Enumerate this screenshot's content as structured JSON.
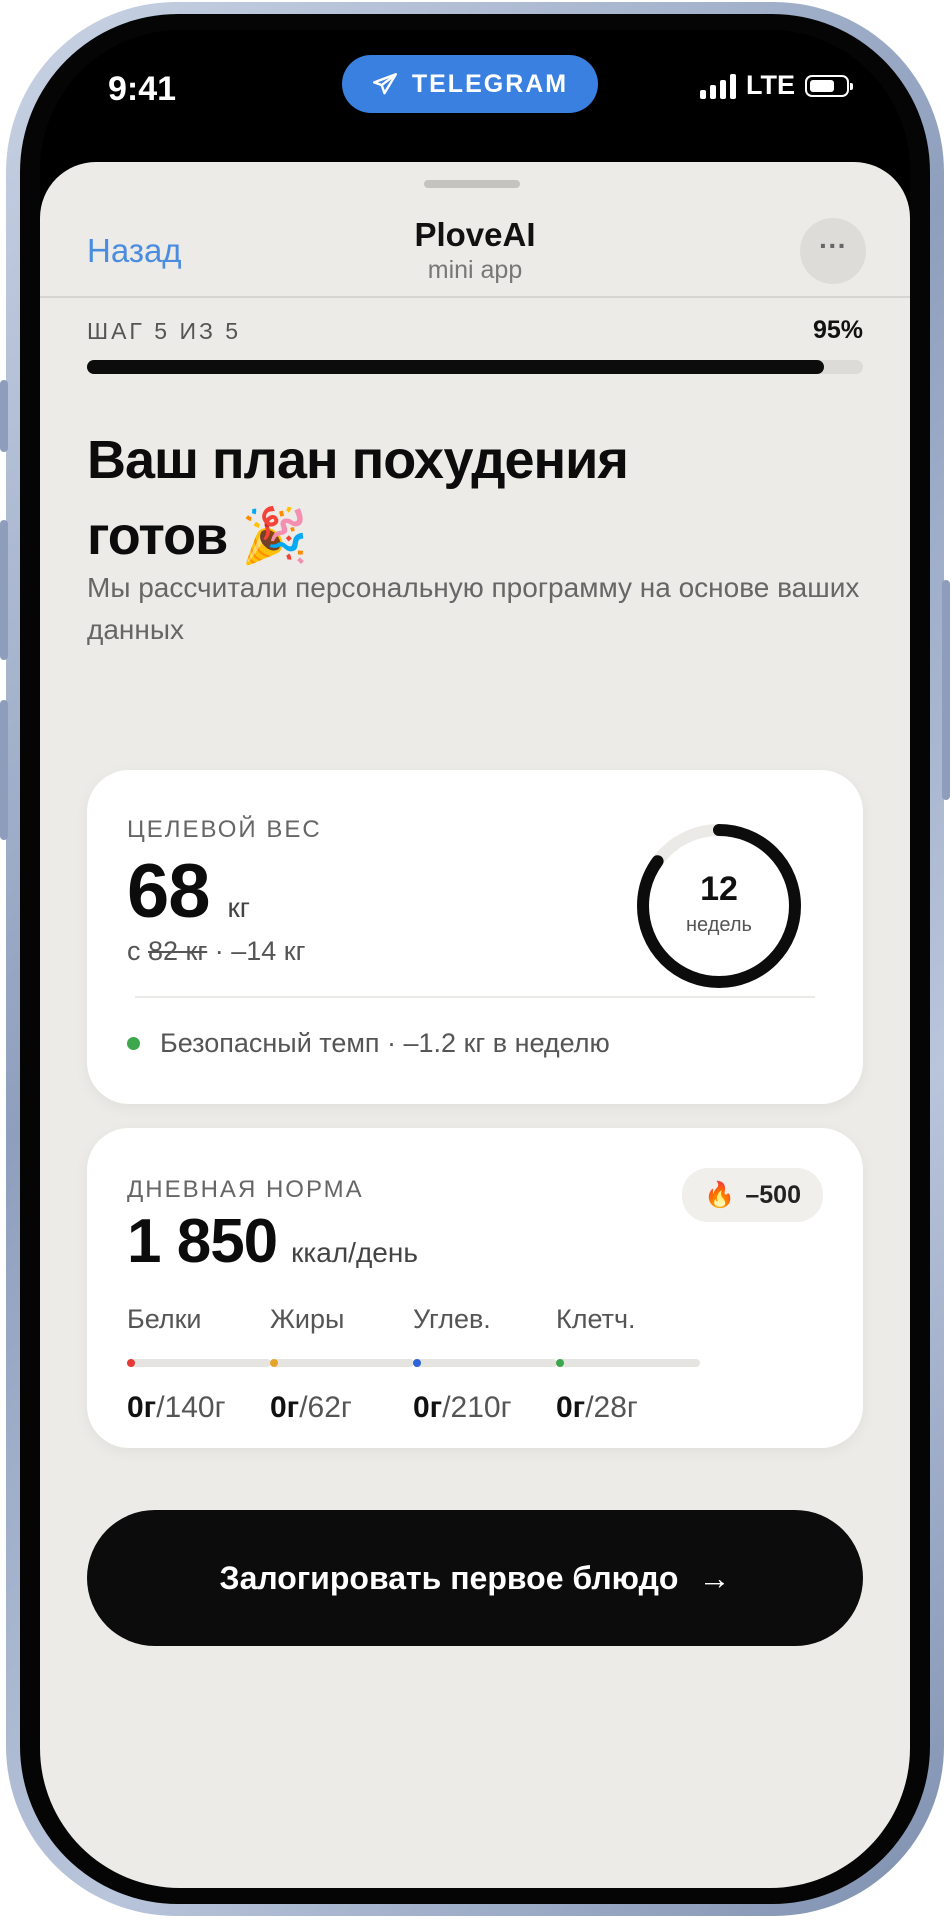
{
  "status_bar": {
    "time": "9:41",
    "network": "LTE",
    "telegram_label": "TELEGRAM"
  },
  "nav": {
    "back": "Назад",
    "title": "PloveAI",
    "subtitle": "mini app",
    "more": "···"
  },
  "progress": {
    "step_label": "ШАГ 5 ИЗ 5",
    "percent_label": "95%",
    "value": 0.95
  },
  "headline": {
    "line1": "Ваш план похудения",
    "line2": "готов",
    "emoji": "🎉"
  },
  "subtitle": "Мы рассчитали персональную программу на основе ваших данных",
  "target_card": {
    "label": "ЦЕЛЕВОЙ ВЕС",
    "value": "68",
    "unit": "кг",
    "from_prefix": "с",
    "from_value": "82 кг",
    "delta": "· –14 кг",
    "weeks_value": "12",
    "weeks_label": "недель",
    "ring_progress": 0.85,
    "pace": "Безопасный темп · –1.2 кг в неделю",
    "pace_color": "#3ca74d"
  },
  "daily_card": {
    "label": "ДНЕВНАЯ НОРМА",
    "value": "1 850",
    "unit": "ккал/день",
    "badge_icon": "🔥",
    "badge": "–500",
    "macros": [
      {
        "name": "Белки",
        "current": "0г",
        "target": "/140г",
        "color": "#e53935"
      },
      {
        "name": "Жиры",
        "current": "0г",
        "target": "/62г",
        "color": "#e6a52a"
      },
      {
        "name": "Углев.",
        "current": "0г",
        "target": "/210г",
        "color": "#2f64d8"
      },
      {
        "name": "Клетч.",
        "current": "0г",
        "target": "/28г",
        "color": "#3ca74d"
      }
    ]
  },
  "cta": {
    "label": "Залогировать первое блюдо",
    "arrow": "→"
  }
}
